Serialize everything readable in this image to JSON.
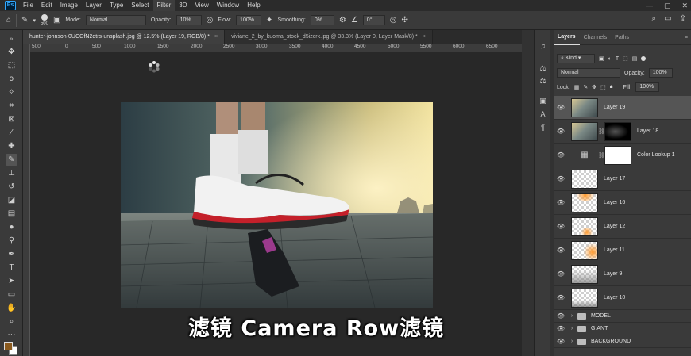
{
  "app": {
    "logo": "Ps",
    "menu": [
      "File",
      "Edit",
      "Image",
      "Layer",
      "Type",
      "Select",
      "Filter",
      "3D",
      "View",
      "Window",
      "Help"
    ],
    "active_menu": "Filter"
  },
  "options_bar": {
    "brush_size": "500",
    "mode_label": "Mode:",
    "mode_value": "Normal",
    "opacity_label": "Opacity:",
    "opacity_value": "10%",
    "flow_label": "Flow:",
    "flow_value": "100%",
    "smoothing_label": "Smoothing:",
    "smoothing_value": "0%",
    "angle_value": "0°"
  },
  "tabs": [
    {
      "label": "hunter-johnson-0UCGfN2qtrs-unsplash.jpg @ 12.5% (Layer 19, RGB/8) *",
      "active": true
    },
    {
      "label": "viviane_2_by_kuoma_stock_d5izcrk.jpg @ 33.3% (Layer 0, Layer Mask/8) *",
      "active": false
    }
  ],
  "ruler": {
    "ticks": [
      "500",
      "0",
      "500",
      "1000",
      "1500",
      "2000",
      "2500",
      "3000",
      "3500",
      "4000",
      "4500",
      "5000",
      "5500",
      "6000",
      "6500"
    ]
  },
  "caption": "滤镜  Camera Row滤镜",
  "layers_panel": {
    "tabs": [
      "Layers",
      "Channels",
      "Paths"
    ],
    "active_tab": "Layers",
    "kind_filter": "Kind",
    "blend_mode": "Normal",
    "opacity_label": "Opacity:",
    "opacity_value": "100%",
    "lock_label": "Lock:",
    "fill_label": "Fill:",
    "fill_value": "100%",
    "layers": [
      {
        "name": "Layer 19",
        "thumb": "photo",
        "selected": true
      },
      {
        "name": "Layer 18",
        "thumb": "photo",
        "mask": "dark"
      },
      {
        "name": "Color Lookup 1",
        "thumb": "adjustment",
        "mask": "white"
      },
      {
        "name": "Layer 17",
        "thumb": "empty"
      },
      {
        "name": "Layer 16",
        "thumb": "orange-top"
      },
      {
        "name": "Layer 12",
        "thumb": "orange-low"
      },
      {
        "name": "Layer 11",
        "thumb": "orange-right"
      },
      {
        "name": "Layer 9",
        "thumb": "gray-fog"
      },
      {
        "name": "Layer 10",
        "thumb": "gray-bottom"
      }
    ],
    "groups": [
      "MODEL",
      "GIANT",
      "BACKGROUND"
    ]
  },
  "colors": {
    "foreground": "#8a5a1e",
    "background": "#ffffff",
    "accent": "#31a8ff"
  }
}
